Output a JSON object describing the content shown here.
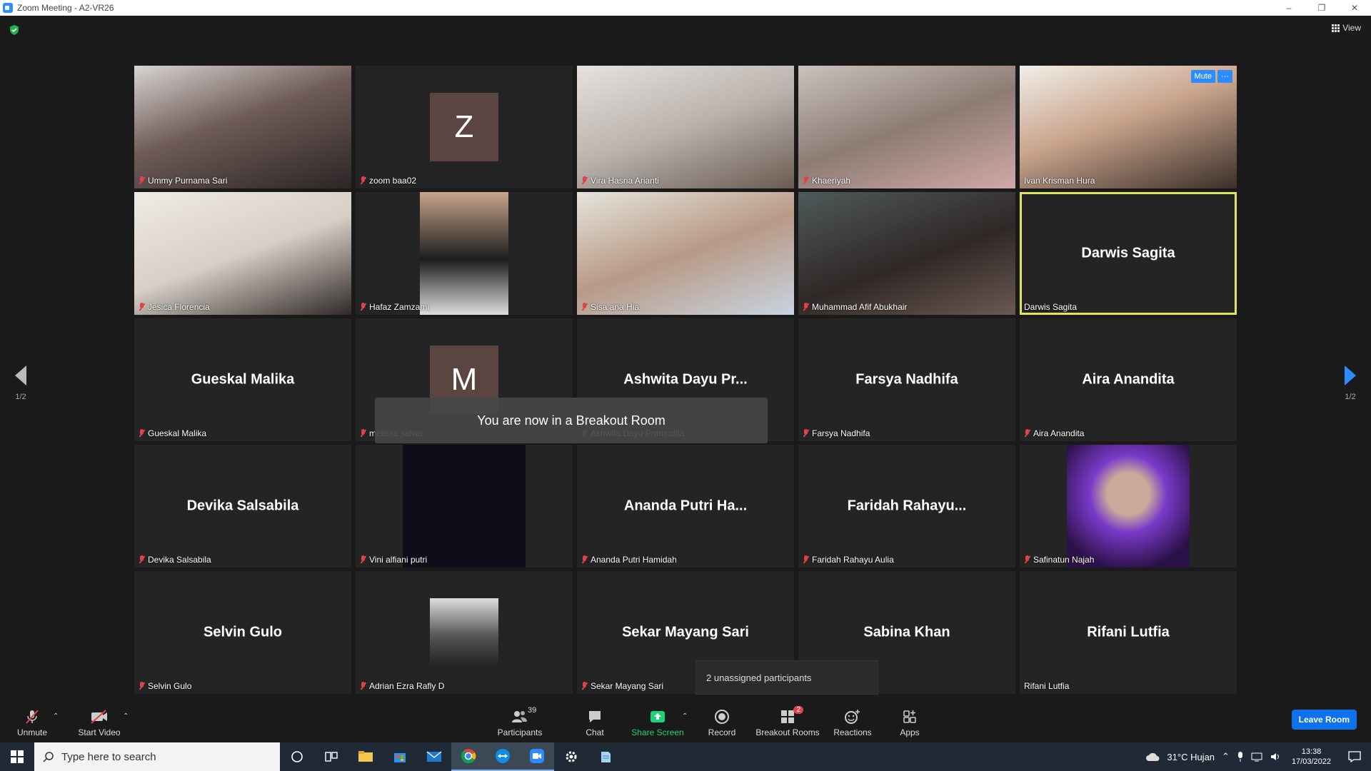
{
  "window": {
    "title": "Zoom Meeting - A2-VR26",
    "minimize": "–",
    "restore": "❐",
    "close": "✕"
  },
  "top": {
    "view_label": "View"
  },
  "tiles": [
    {
      "name": "Ummy Purnama Sari",
      "kind": "video",
      "muted": true
    },
    {
      "name": "zoom baa02",
      "kind": "avatar",
      "initial": "Z",
      "muted": true
    },
    {
      "name": "Vira Hasna Arianti",
      "kind": "video",
      "muted": true
    },
    {
      "name": "Khaeriyah",
      "kind": "video",
      "muted": true
    },
    {
      "name": "Ivan Krisman Hura",
      "kind": "video",
      "muted": false
    },
    {
      "name": "Jesica Florencia",
      "kind": "video",
      "muted": true
    },
    {
      "name": "Hafaz Zamzami",
      "kind": "video",
      "muted": true
    },
    {
      "name": "Sisa ana Hia",
      "kind": "video",
      "muted": true
    },
    {
      "name": "Muhammad Afif Abukhair",
      "kind": "video",
      "muted": true
    },
    {
      "name": "Darwis Sagita",
      "kind": "name",
      "display": "Darwis Sagita",
      "muted": false,
      "active": true
    },
    {
      "name": "Gueskal Malika",
      "kind": "name",
      "display": "Gueskal Malika",
      "muted": true
    },
    {
      "name": "melissa salwa",
      "kind": "avatar",
      "initial": "M",
      "muted": true
    },
    {
      "name": "Ashwita Dayu Pramudita",
      "kind": "name",
      "display": "Ashwita Dayu Pr...",
      "muted": true
    },
    {
      "name": "Farsya Nadhifa",
      "kind": "name",
      "display": "Farsya Nadhifa",
      "muted": true
    },
    {
      "name": "Aira Anandita",
      "kind": "name",
      "display": "Aira Anandita",
      "muted": true
    },
    {
      "name": "Devika Salsabila",
      "kind": "name",
      "display": "Devika Salsabila",
      "muted": true
    },
    {
      "name": "Vini alfiani putri",
      "kind": "darkphoto",
      "muted": true
    },
    {
      "name": "Ananda Putri Hamidah",
      "kind": "name",
      "display": "Ananda Putri Ha...",
      "muted": true
    },
    {
      "name": "Faridah Rahayu Aulia",
      "kind": "name",
      "display": "Faridah  Rahayu...",
      "muted": true
    },
    {
      "name": "Safinatun Najah",
      "kind": "photo",
      "muted": true
    },
    {
      "name": "Selvin Gulo",
      "kind": "name",
      "display": "Selvin Gulo",
      "muted": true
    },
    {
      "name": "Adrian Ezra Rafly D",
      "kind": "photo-small",
      "muted": true
    },
    {
      "name": "Sekar Mayang Sari",
      "kind": "name",
      "display": "Sekar Mayang Sari",
      "muted": true
    },
    {
      "name": "Sabina Khan",
      "kind": "name",
      "display": "Sabina Khan",
      "muted": false
    },
    {
      "name": "Rifani Lutfia",
      "kind": "name",
      "display": "Rifani Lutfia",
      "muted": false
    }
  ],
  "tile_controls": {
    "mute": "Mute",
    "more": "···"
  },
  "pager": {
    "prev": "1/2",
    "next": "1/2"
  },
  "notifications": {
    "breakout": "You are now in a Breakout Room",
    "unassigned": "2 unassigned participants"
  },
  "toolbar": {
    "unmute": "Unmute",
    "start_video": "Start Video",
    "participants": "Participants",
    "participants_count": "39",
    "chat": "Chat",
    "share_screen": "Share Screen",
    "record": "Record",
    "breakout_rooms": "Breakout Rooms",
    "breakout_badge": "2",
    "reactions": "Reactions",
    "apps": "Apps",
    "leave": "Leave Room"
  },
  "taskbar": {
    "search_placeholder": "Type here to search",
    "weather": "31°C  Hujan",
    "time": "13:38",
    "date": "17/03/2022"
  },
  "colors": {
    "accent": "#2d8cff",
    "active_speaker": "#e0e65a",
    "muted": "#e0424b",
    "share": "#22d07a"
  }
}
